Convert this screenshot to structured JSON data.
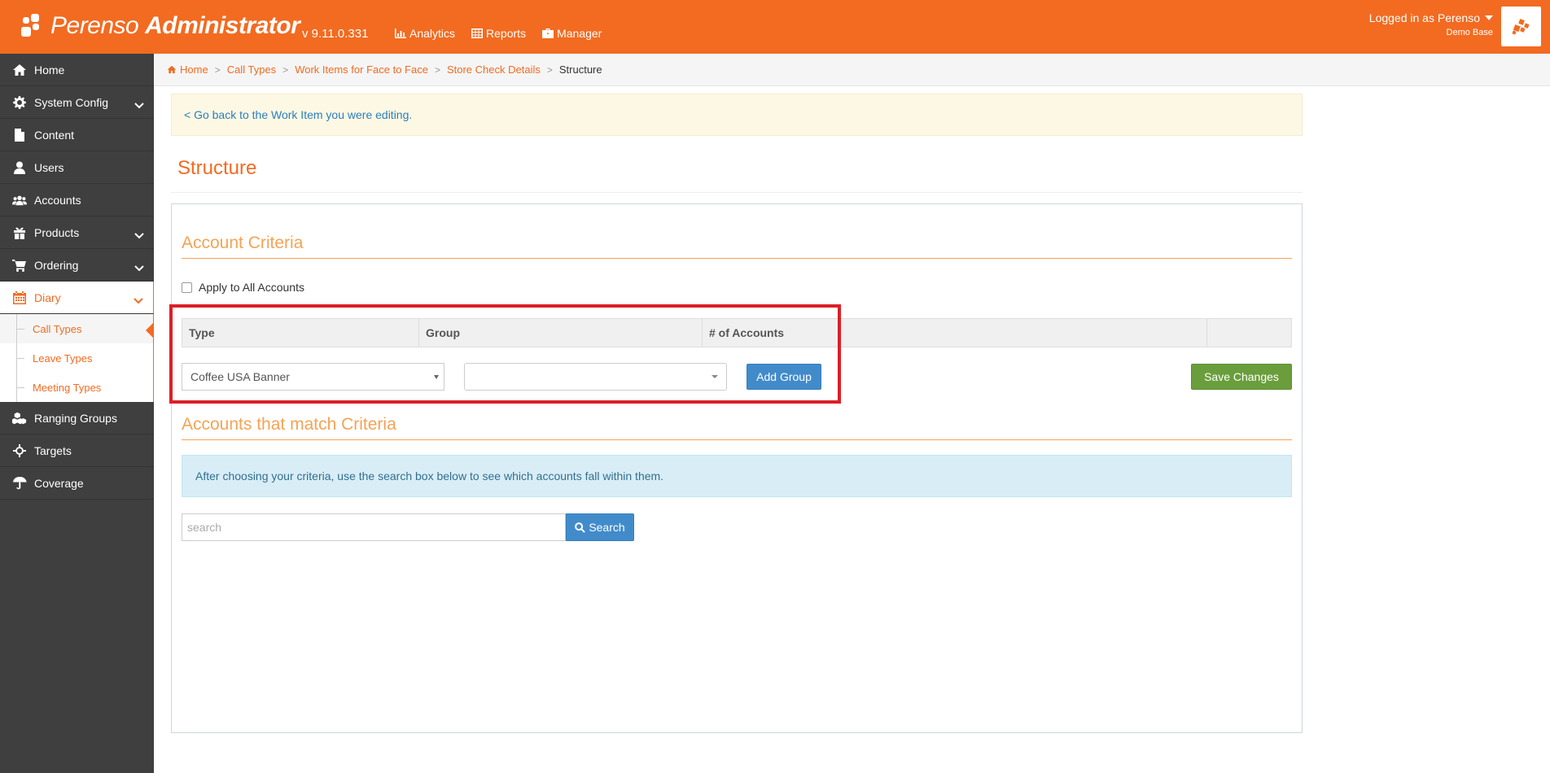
{
  "app": {
    "brand_light": "Perenso",
    "brand_bold": "Administrator",
    "version": "v 9.11.0.331"
  },
  "topnav": [
    {
      "label": "Analytics",
      "icon": "chart-icon"
    },
    {
      "label": "Reports",
      "icon": "table-icon"
    },
    {
      "label": "Manager",
      "icon": "briefcase-icon"
    }
  ],
  "user": {
    "logged_in": "Logged in as Perenso",
    "base": "Demo Base"
  },
  "sidebar": {
    "items": [
      {
        "label": "Home",
        "icon": "home-icon"
      },
      {
        "label": "System Config",
        "icon": "gear-icon"
      },
      {
        "label": "Content",
        "icon": "file-icon"
      },
      {
        "label": "Users",
        "icon": "user-icon"
      },
      {
        "label": "Accounts",
        "icon": "users-icon"
      },
      {
        "label": "Products",
        "icon": "gift-icon"
      },
      {
        "label": "Ordering",
        "icon": "cart-icon"
      },
      {
        "label": "Diary",
        "icon": "calendar-icon"
      },
      {
        "label": "Ranging Groups",
        "icon": "cubes-icon"
      },
      {
        "label": "Targets",
        "icon": "crosshairs-icon"
      },
      {
        "label": "Coverage",
        "icon": "umbrella-icon"
      }
    ],
    "diary_sub": [
      {
        "label": "Call Types"
      },
      {
        "label": "Leave Types"
      },
      {
        "label": "Meeting Types"
      }
    ]
  },
  "breadcrumb": {
    "items": [
      "Home",
      "Call Types",
      "Work Items for Face to Face",
      "Store Check Details"
    ],
    "current": "Structure",
    "separator": ">"
  },
  "back_link": "< Go back to the Work Item you were editing.",
  "page_title": "Structure",
  "account_criteria": {
    "title": "Account Criteria",
    "apply_all_label": "Apply to All Accounts",
    "columns": [
      "Type",
      "Group",
      "# of Accounts",
      ""
    ],
    "type_selected": "Coffee USA Banner",
    "group_selected": "",
    "add_group_label": "Add Group",
    "save_label": "Save Changes"
  },
  "matching": {
    "title": "Accounts that match Criteria",
    "info": "After choosing your criteria, use the search box below to see which accounts fall within them.",
    "search_placeholder": "search",
    "search_button": "Search"
  },
  "colors": {
    "brand": "#f26b21",
    "sidebar_bg": "#3f3f3f",
    "button_blue": "#428bca",
    "button_green": "#6a9e3c",
    "highlight_red": "#dc1f26"
  }
}
